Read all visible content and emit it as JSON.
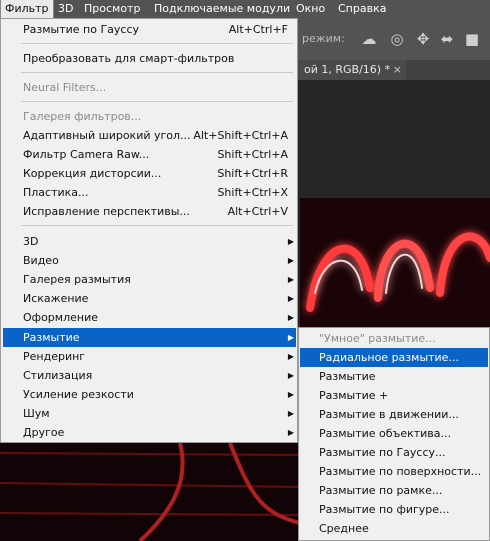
{
  "menubar": {
    "items": [
      "Фильтр",
      "3D",
      "Просмотр",
      "Подключаемые модули",
      "Окно",
      "Справка"
    ]
  },
  "options_bar": {
    "mode_label": "режим:",
    "icons": [
      "rotate-3d-icon",
      "orbit-icon",
      "pan-icon",
      "slide-icon",
      "video-camera-icon"
    ]
  },
  "document_tab": {
    "title": "ой 1, RGB/16) *",
    "close": "×"
  },
  "filter_menu": {
    "top_items": [
      {
        "label": "Размытие по Гауссу",
        "shortcut": "Alt+Ctrl+F"
      },
      {
        "label": "Преобразовать для смарт-фильтров",
        "shortcut": ""
      },
      {
        "label": "Neural Filters...",
        "shortcut": ""
      }
    ],
    "gallery_items": [
      {
        "label": "Галерея фильтров...",
        "shortcut": ""
      },
      {
        "label": "Адаптивный широкий угол...",
        "shortcut": "Alt+Shift+Ctrl+A"
      },
      {
        "label": "Фильтр Camera Raw...",
        "shortcut": "Shift+Ctrl+A"
      },
      {
        "label": "Коррекция дисторсии...",
        "shortcut": "Shift+Ctrl+R"
      },
      {
        "label": "Пластика...",
        "shortcut": "Shift+Ctrl+X"
      },
      {
        "label": "Исправление перспективы...",
        "shortcut": "Alt+Ctrl+V"
      }
    ],
    "submenus": [
      "3D",
      "Видео",
      "Галерея размытия",
      "Искажение",
      "Оформление",
      "Размытие",
      "Рендеринг",
      "Стилизация",
      "Усиление резкости",
      "Шум",
      "Другое"
    ],
    "arrow": "▶"
  },
  "blur_submenu": {
    "items": [
      "\"Умное\" размытие...",
      "Радиальное размытие...",
      "Размытие",
      "Размытие +",
      "Размытие в движении...",
      "Размытие объектива...",
      "Размытие по Гауссу...",
      "Размытие по поверхности...",
      "Размытие по рамке...",
      "Размытие по фигуре...",
      "Среднее"
    ]
  }
}
